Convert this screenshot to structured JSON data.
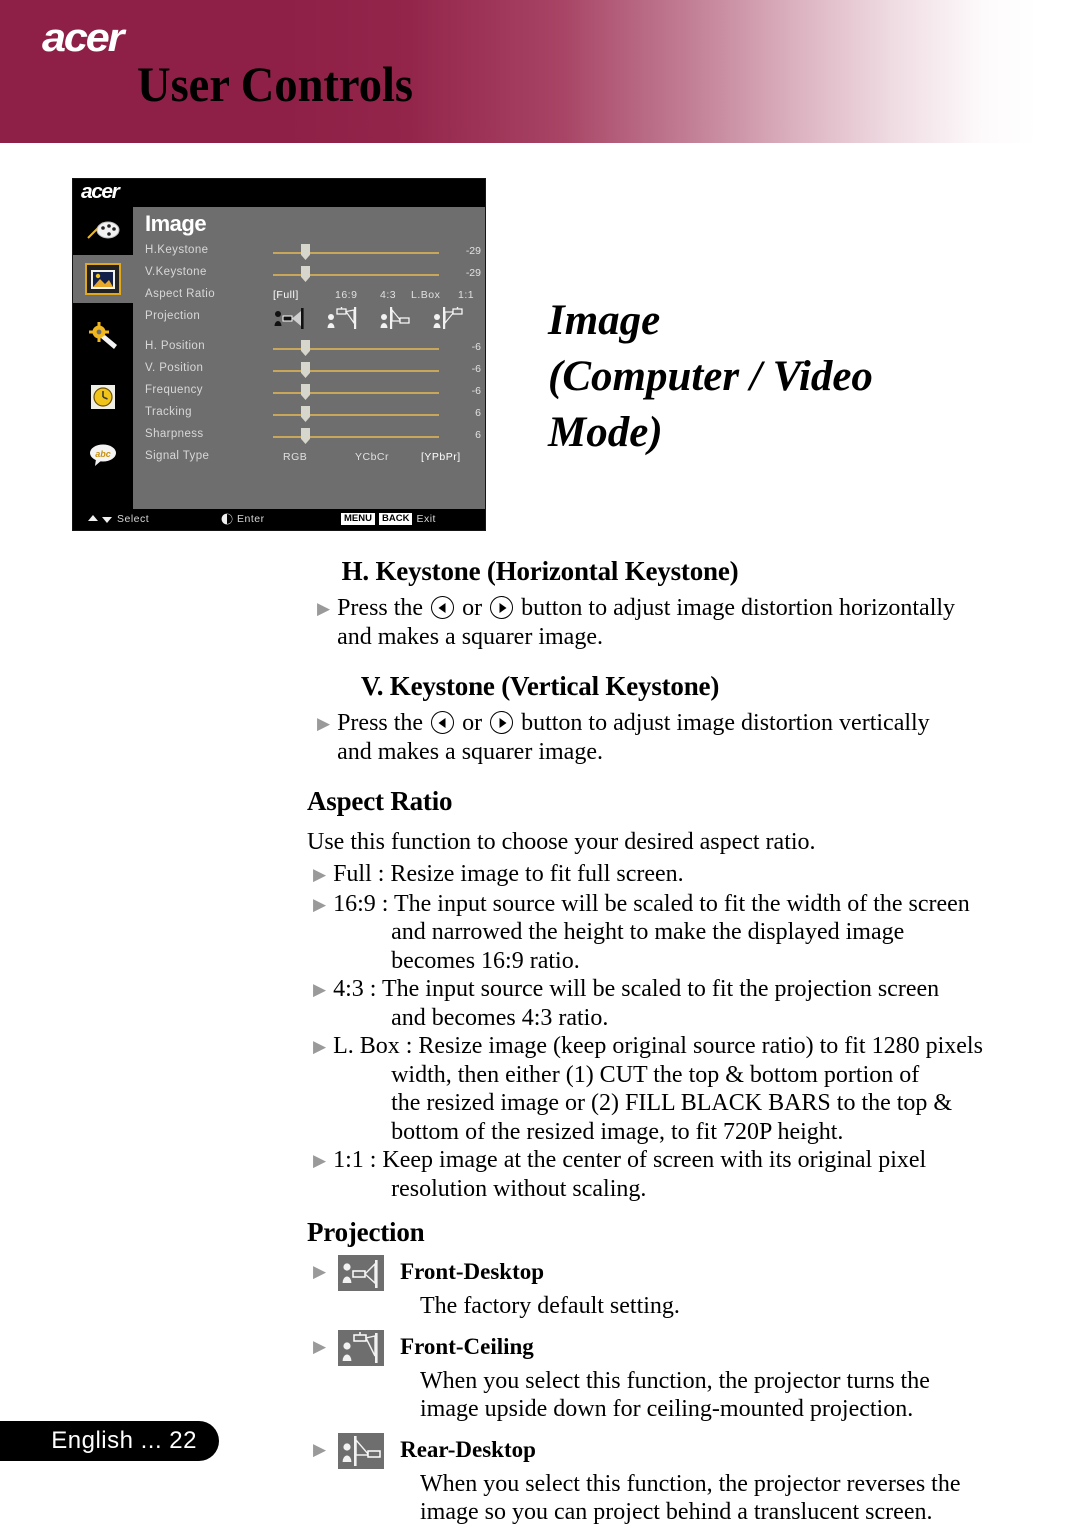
{
  "header": {
    "logo": "acer",
    "title": "User Controls",
    "brand_color": "#8e2047"
  },
  "osd": {
    "logo": "acer",
    "heading": "Image",
    "sidebar_icons": [
      "color-palette-icon",
      "image-icon",
      "settings-wrench-icon",
      "clock-icon",
      "language-abc-icon"
    ],
    "selected_sidebar_icon": "image-icon",
    "rows": [
      {
        "label": "H.Keystone",
        "type": "slider",
        "value": "-29"
      },
      {
        "label": "V.Keystone",
        "type": "slider",
        "value": "-29"
      },
      {
        "label": "Aspect Ratio",
        "type": "options",
        "options": [
          "[Full]",
          "16:9",
          "4:3",
          "L.Box",
          "1:1"
        ],
        "selected": "[Full]"
      },
      {
        "label": "Projection",
        "type": "icons",
        "icons": [
          "front-desktop-icon",
          "front-ceiling-icon",
          "rear-desktop-icon",
          "rear-ceiling-icon"
        ],
        "selected": "front-desktop-icon"
      },
      {
        "label": "H. Position",
        "type": "slider",
        "value": "-6"
      },
      {
        "label": "V. Position",
        "type": "slider",
        "value": "-6"
      },
      {
        "label": "Frequency",
        "type": "slider",
        "value": "-6"
      },
      {
        "label": "Tracking",
        "type": "slider",
        "value": "6"
      },
      {
        "label": "Sharpness",
        "type": "slider",
        "value": "6"
      },
      {
        "label": "Signal Type",
        "type": "options",
        "options": [
          "RGB",
          "YCbCr",
          "[YPbPr]"
        ],
        "selected": "[YPbPr]"
      }
    ],
    "hints": {
      "select": "Select",
      "enter": "Enter",
      "menu_key": "MENU",
      "back_key": "BACK",
      "exit": "Exit"
    }
  },
  "side_title": {
    "line1": "Image",
    "line2": "(Computer / Video",
    "line3": "Mode)"
  },
  "sections": {
    "h_keystone": {
      "heading": "H. Keystone (Horizontal Keystone)",
      "bullet_line1_a": "Press the",
      "bullet_line1_b": "or",
      "bullet_line1_c": "button to adjust image distortion horizontally",
      "bullet_line2": "and makes a squarer image."
    },
    "v_keystone": {
      "heading": "V. Keystone (Vertical Keystone)",
      "bullet_line1_a": "Press the",
      "bullet_line1_b": "or",
      "bullet_line1_c": "button to adjust image distortion vertically",
      "bullet_line2": "and makes a squarer image."
    },
    "aspect_ratio": {
      "heading": "Aspect Ratio",
      "intro": "Use this function to choose your desired aspect ratio.",
      "items": [
        {
          "line1": "Full : Resize image to fit full screen.",
          "cont": []
        },
        {
          "line1": "16:9 : The input source will be scaled to fit the width of the screen",
          "cont": [
            "and narrowed the height to make the displayed image",
            "becomes 16:9 ratio."
          ]
        },
        {
          "line1": "4:3 : The input source will be scaled to fit the projection screen",
          "cont": [
            "and becomes 4:3 ratio."
          ]
        },
        {
          "line1": "L. Box : Resize image (keep original source ratio) to fit 1280 pixels",
          "cont": [
            "width, then either (1) CUT the top & bottom portion of",
            "the resized image or (2) FILL BLACK BARS to the top &",
            "bottom of the resized image, to fit 720P height."
          ]
        },
        {
          "line1": "1:1 : Keep image at the center of screen with its original pixel",
          "cont": [
            "resolution without scaling."
          ]
        }
      ]
    },
    "projection": {
      "heading": "Projection",
      "items": [
        {
          "icon": "front-desktop-icon",
          "label": "Front-Desktop",
          "desc": [
            "The factory default setting."
          ]
        },
        {
          "icon": "front-ceiling-icon",
          "label": "Front-Ceiling",
          "desc": [
            "When you select this function, the projector turns the",
            "image upside down for ceiling-mounted projection."
          ]
        },
        {
          "icon": "rear-desktop-icon",
          "label": "Rear-Desktop",
          "desc": [
            "When you select this function, the projector reverses the",
            "image  so you can project behind a translucent screen."
          ]
        }
      ]
    }
  },
  "footer": {
    "label": "English ...   22"
  }
}
